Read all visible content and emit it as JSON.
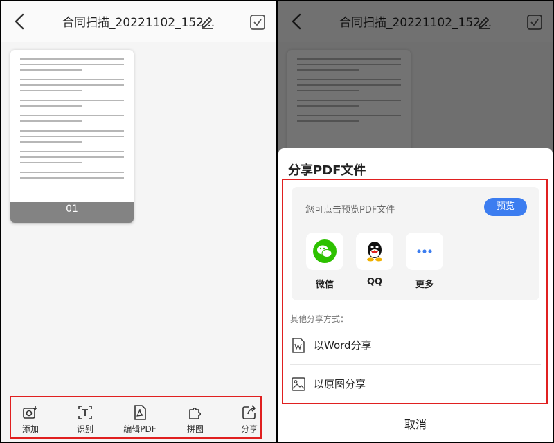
{
  "header": {
    "title": "合同扫描_20221102_152..."
  },
  "document": {
    "page_number": "01"
  },
  "toolbar": {
    "items": [
      {
        "label": "添加",
        "icon": "camera-add-icon"
      },
      {
        "label": "识别",
        "icon": "text-recognize-icon"
      },
      {
        "label": "编辑PDF",
        "icon": "pdf-edit-icon"
      },
      {
        "label": "拼图",
        "icon": "puzzle-icon"
      },
      {
        "label": "分享",
        "icon": "share-icon"
      }
    ]
  },
  "share_sheet": {
    "title": "分享PDF文件",
    "hint": "您可点击预览PDF文件",
    "preview_label": "预览",
    "apps": [
      {
        "label": "微信",
        "icon": "wechat-icon"
      },
      {
        "label": "QQ",
        "icon": "qq-icon"
      },
      {
        "label": "更多",
        "icon": "more-icon"
      }
    ],
    "other_label": "其他分享方式：",
    "options": [
      {
        "label": "以Word分享",
        "icon": "word-file-icon"
      },
      {
        "label": "以原图分享",
        "icon": "image-icon"
      }
    ],
    "cancel_label": "取消"
  },
  "colors": {
    "accent": "#3c7df0",
    "highlight_border": "#e02020",
    "wechat": "#2dc100"
  }
}
